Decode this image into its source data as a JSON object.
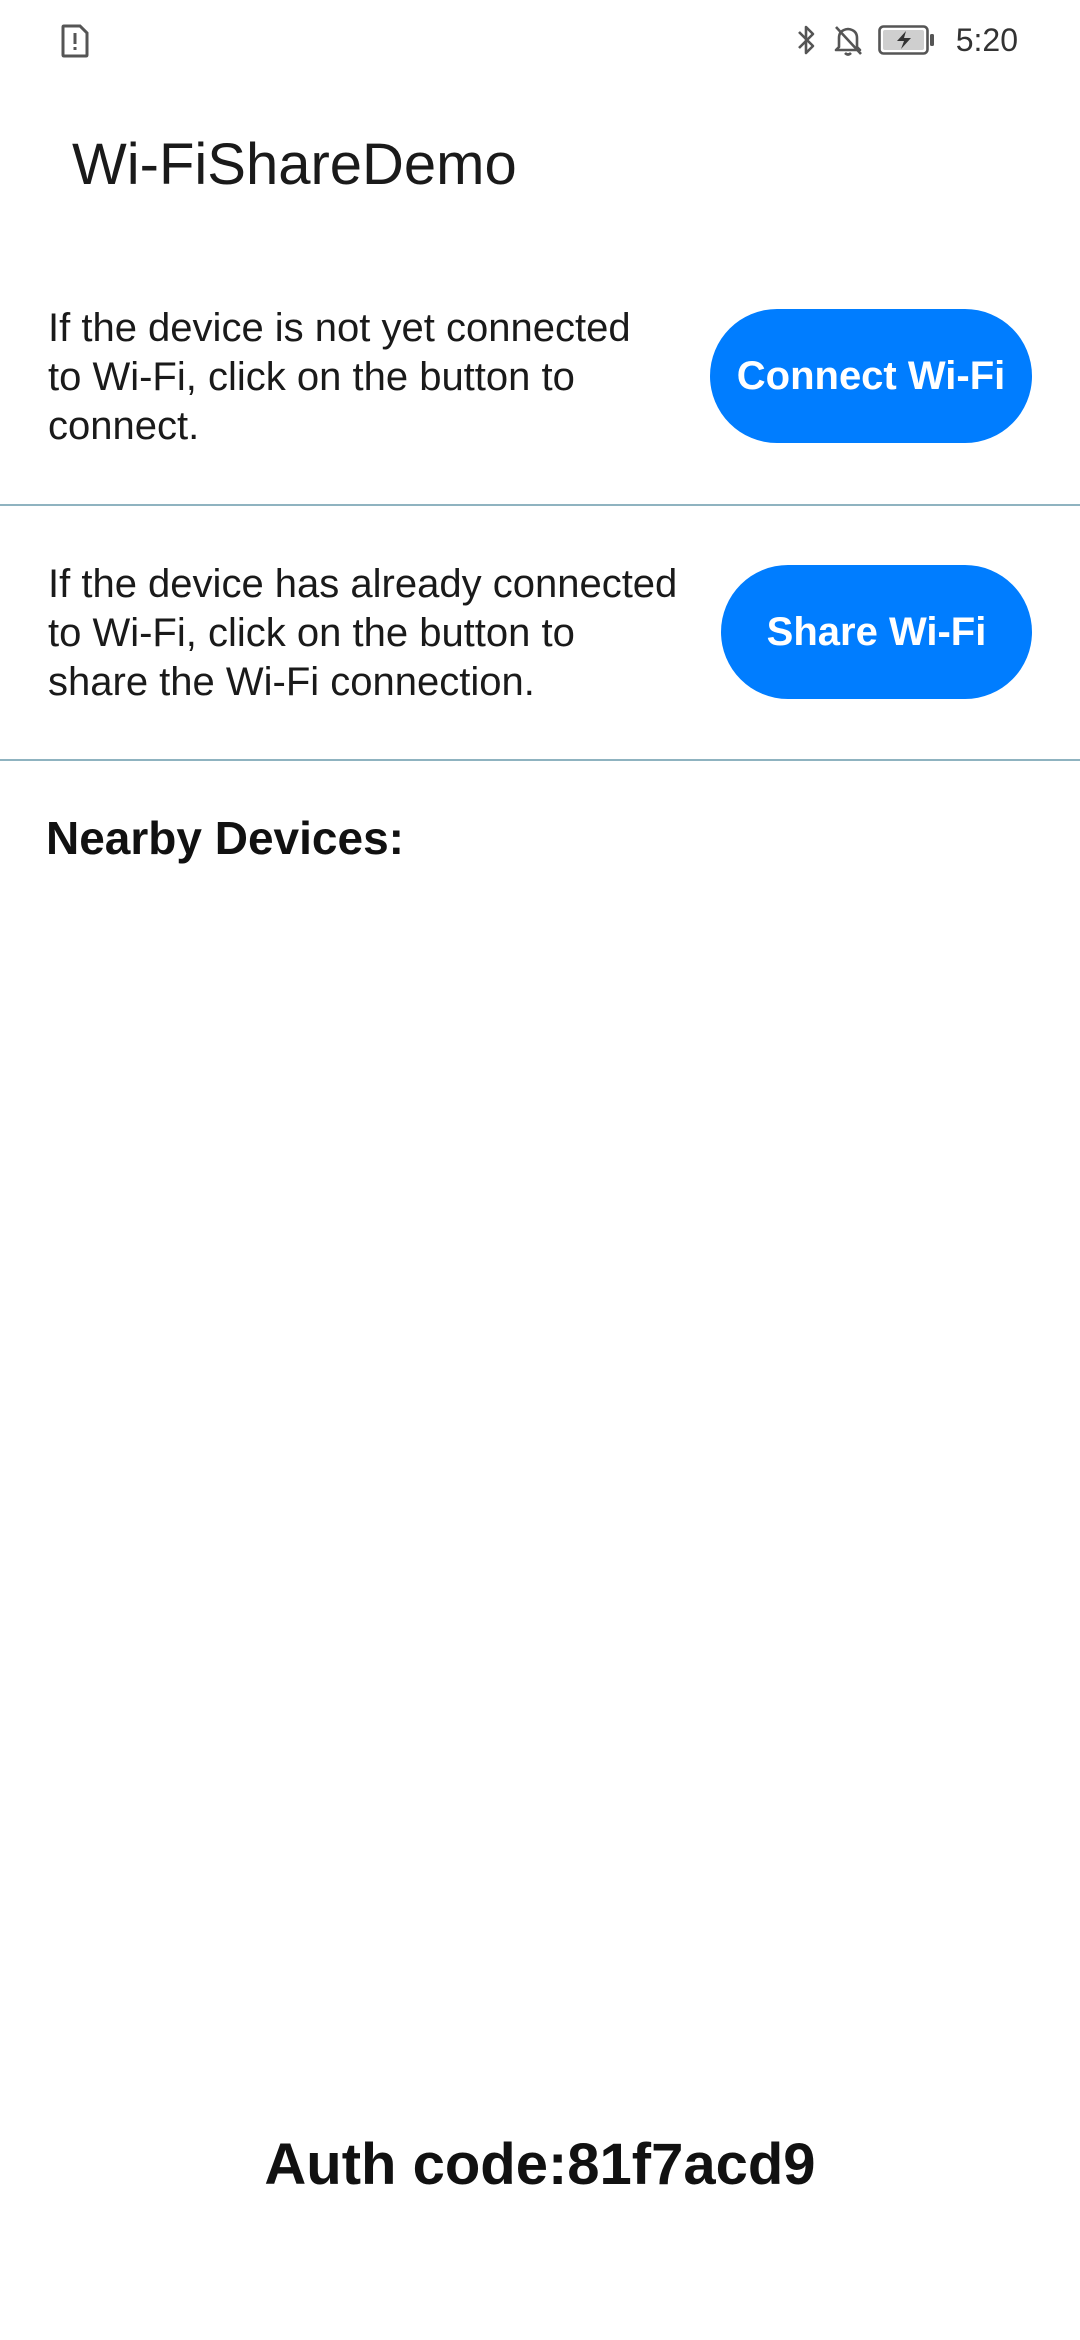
{
  "status_bar": {
    "time": "5:20",
    "icons": [
      "sim-alert-icon",
      "bluetooth-icon",
      "notifications-off-icon",
      "battery-charging-icon"
    ]
  },
  "app": {
    "title": "Wi-FiShareDemo"
  },
  "connect_section": {
    "line1": "If the device is not yet connected",
    "line2": "to Wi-Fi, click on the button to",
    "line3": "connect.",
    "button_label": "Connect Wi-Fi"
  },
  "share_section": {
    "line1": "If the device has already connected",
    "line2": "to Wi-Fi, click on the button to",
    "line3": "share the Wi-Fi connection.",
    "button_label": "Share Wi-Fi"
  },
  "nearby": {
    "title": "Nearby Devices:",
    "devices": []
  },
  "auth": {
    "text": "Auth code:81f7acd9"
  },
  "colors": {
    "accent": "#007dff",
    "divider": "#8fb3c0",
    "text": "#1a1a1a"
  }
}
